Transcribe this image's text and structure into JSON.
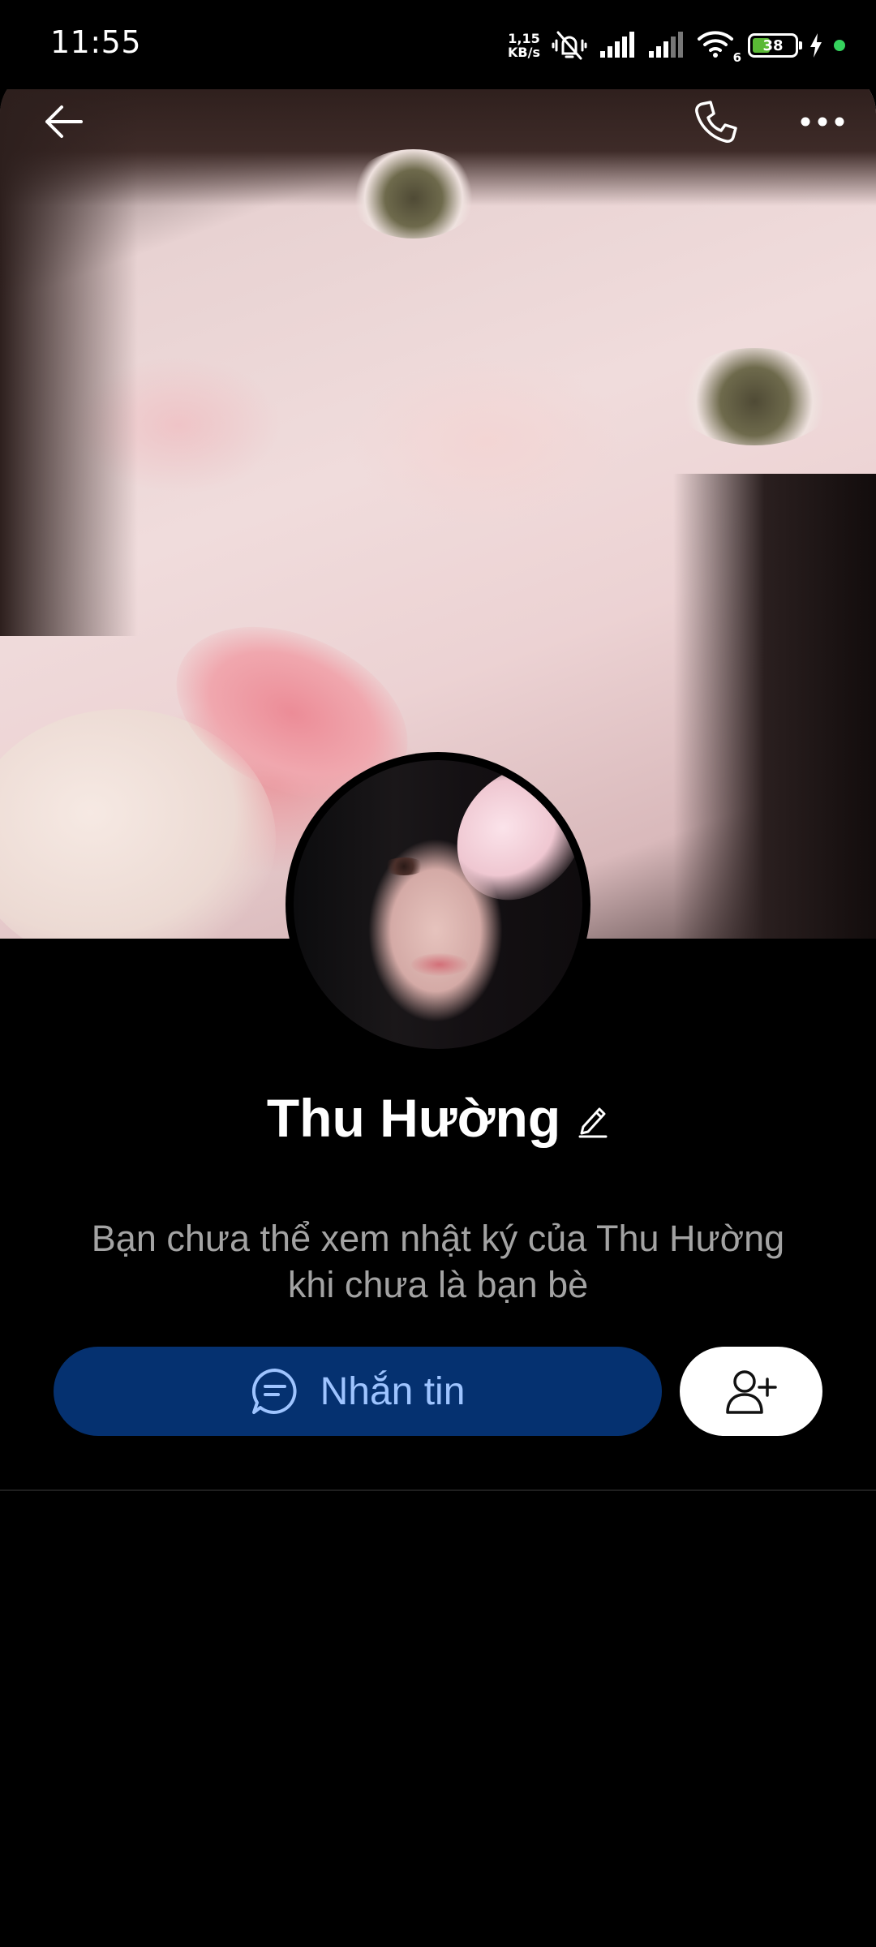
{
  "status_bar": {
    "time": "11:55",
    "net_speed_value": "1,15",
    "net_speed_unit": "KB/s",
    "signal_sub": "6",
    "battery_level": "38",
    "battery_color": "#5ab935"
  },
  "header": {
    "back_icon": "arrow-left-icon",
    "call_icon": "phone-icon",
    "more_icon": "more-horizontal-icon"
  },
  "profile": {
    "name": "Thu Hường",
    "edit_icon": "pencil-icon",
    "notice_line1": "Bạn chưa thể xem nhật ký của Thu Hường",
    "notice_line2": "khi chưa là bạn bè"
  },
  "actions": {
    "message_label": "Nhắn tin",
    "message_icon": "chat-bubble-icon",
    "message_bg": "#053170",
    "message_text_color": "#9ec4ff",
    "add_friend_icon": "add-user-icon"
  }
}
